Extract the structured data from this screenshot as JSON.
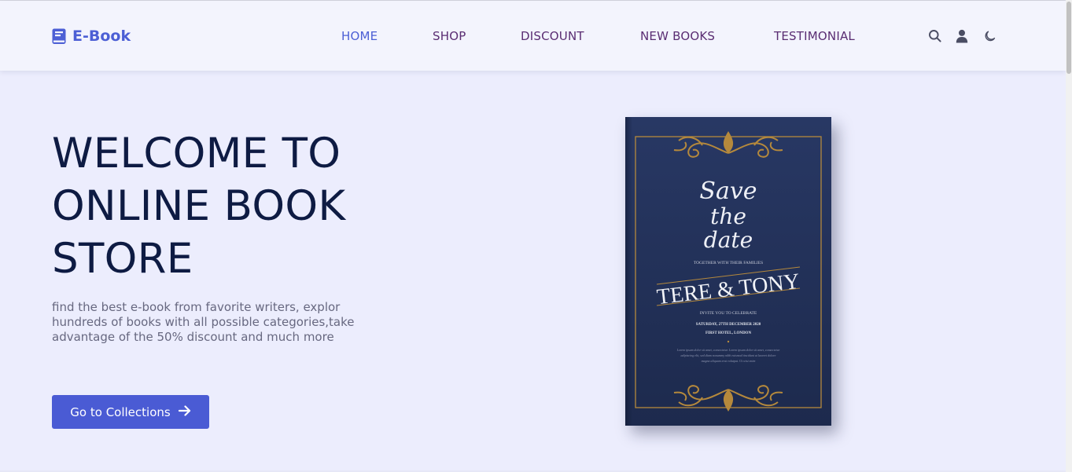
{
  "header": {
    "logo_text": "E-Book",
    "nav": [
      {
        "label": "HOME",
        "active": true
      },
      {
        "label": "SHOP"
      },
      {
        "label": "DISCOUNT"
      },
      {
        "label": "NEW BOOKS"
      },
      {
        "label": "TESTIMONIAL"
      }
    ],
    "icons": [
      "book-icon",
      "search-icon",
      "user-icon",
      "moon-icon"
    ]
  },
  "hero": {
    "title_lines": [
      "WELCOME TO",
      "ONLINE BOOK",
      "STORE"
    ],
    "description": "find the best e-book from favorite writers, explor hundreds of books with all possible categories,take advantage of the 50% discount and much more",
    "cta_label": "Go to Collections",
    "cta_icon": "arrow-right-icon"
  },
  "book_cover": {
    "script_lines": [
      "Save",
      "the",
      "date"
    ],
    "together_line": "TOGETHER WITH THEIR FAMILIES",
    "names": "TERE & TONY",
    "invite_line": "INVITE YOU TO CELEBRATE",
    "date_line": "SATURDAY, 27TH DECEMBER 2020",
    "venue_line": "FIRST HOTEL, LONDON",
    "lorem_lines": [
      "Lorem ipsum dolor sit amet, consectetur. Lorem ipsum dolor sit amet, consectetur",
      "adipiscing elit, sed diam nonummy nibh euismod tincidunt ut laoreet dolore",
      "magna aliquam erat volutpat. Ut wisi enim"
    ]
  },
  "colors": {
    "accent": "#4c5fd5",
    "nav_text": "#5a2d72",
    "title": "#0e1b43",
    "background": "#ecedfd",
    "cover_navy": "#213056",
    "cover_gold": "#b5893c"
  }
}
